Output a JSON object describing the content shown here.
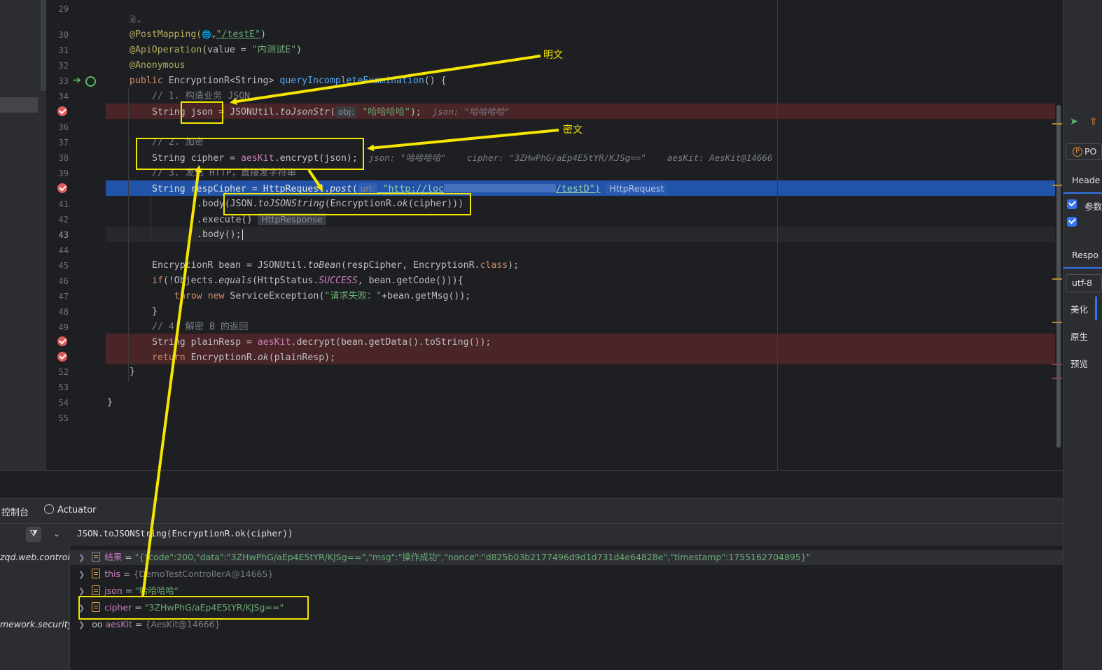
{
  "editor": {
    "line_numbers": [
      "29",
      "30",
      "31",
      "32",
      "33",
      "34",
      "35",
      "36",
      "37",
      "38",
      "39",
      "40",
      "41",
      "42",
      "43",
      "44",
      "45",
      "46",
      "47",
      "48",
      "49",
      "50",
      "51",
      "52",
      "53",
      "54",
      "55"
    ],
    "fold_hint": "🗟⌄",
    "lines": {
      "l30_ann": "@PostMapping(",
      "l30_globe": "🌐⌄",
      "l30_str": "\"/testE\"",
      "l30_end": ")",
      "l31_ann": "@ApiOperation",
      "l31_a": "(value = ",
      "l31_str": "\"内测试E\"",
      "l31_end": ")",
      "l32_ann": "@Anonymous",
      "l33_kw": "public ",
      "l33_type": "EncryptionR<String> ",
      "l33_fn": "queryIncompleteExamination",
      "l33_end": "() {",
      "l34_cm": "// 1. 构造业务 JSON",
      "l35_a": "String json = JSONUtil.",
      "l35_it": "toJsonStr",
      "l35_b": "(",
      "l35_hint": "obj:",
      "l35_str": " \"哈哈哈哈\"",
      "l35_end": ");",
      "l35_inlay": "json: \"哈哈哈哈\"",
      "l37_cm": "// 2. 加密",
      "l38_a": "String cipher = ",
      "l38_fld": "aesKit",
      "l38_b": ".encrypt(json);",
      "l38_inlay": "json: \"哈哈哈哈\"    cipher: \"3ZHwPhG/aEp4E5tYR/KJSg==\"    aesKit: AesKit@14666",
      "l39_cm": "// 3. 发送 HTTP，直接发字符串",
      "l40_a": "String respCipher = HttpRequest.",
      "l40_it": "post",
      "l40_b": "(",
      "l40_hint": "url:",
      "l40_str": " \"http://loc",
      "l40_str2": "/testD\")",
      "l40_tail": "HttpRequest",
      "l41_a": ".body(JSON.",
      "l41_it": "toJSONString",
      "l41_b": "(EncryptionR.",
      "l41_it2": "ok",
      "l41_c": "(cipher)))",
      "l42_a": ".execute()",
      "l42_tail": "HttpResponse",
      "l43_a": ".body();",
      "l45_a": "EncryptionR bean = JSONUtil.",
      "l45_it": "toBean",
      "l45_b": "(respCipher, EncryptionR.",
      "l45_kw": "class",
      "l45_c": ");",
      "l46_kw": "if",
      "l46_a": "(!Objects.",
      "l46_it": "equals",
      "l46_b": "(HttpStatus.",
      "l46_cn": "SUCCESS",
      "l46_c": ", bean.getCode())){",
      "l47_kw": "throw new ",
      "l47_a": "ServiceException(",
      "l47_str": "\"请求失败：\"",
      "l47_b": "+bean.getMsg());",
      "l48_a": "}",
      "l49_cm": "// 4. 解密 B 的返回",
      "l50_a": "String plainResp = ",
      "l50_fld": "aesKit",
      "l50_b": ".decrypt(bean.getData().toString());",
      "l51_kw": "return ",
      "l51_a": "EncryptionR.",
      "l51_it": "ok",
      "l51_b": "(plainResp);",
      "l52_a": "}",
      "l54_a": "}"
    }
  },
  "annotations": {
    "plaintext_label": "明文",
    "ciphertext_label": "密文",
    "color": "#f4e600"
  },
  "right_panel": {
    "method_badge": "P",
    "method_text": "PO",
    "headers_tab": "Heade",
    "params_label": "参数",
    "response_tab": "Respo",
    "encoding": "utf-8",
    "beautify": "美化",
    "raw": "原生",
    "preview": "预览"
  },
  "bottom": {
    "tab_console": "控制台",
    "tab_actuator": "Actuator",
    "expression": "JSON.toJSONString(EncryptionR.ok(cipher))",
    "frames": [
      "zqd.web.controlle",
      "mework.security.i"
    ],
    "variables": [
      {
        "name": "结果",
        "value": "\"{\"code\":200,\"data\":\"3ZHwPhG/aEp4E5tYR/KJSg==\",\"msg\":\"操作成功\",\"nonce\":\"d825b03b2177496d9d1d731d4e64828e\",\"timestamp\":1755162704895}\""
      },
      {
        "name": "this",
        "value": "{DemoTestControllerA@14665}"
      },
      {
        "name": "json",
        "value": "\"哈哈哈哈\""
      },
      {
        "name": "cipher",
        "value": "\"3ZHwPhG/aEp4E5tYR/KJSg==\""
      },
      {
        "name": "aesKit",
        "value": "{AesKit@14666}"
      }
    ]
  }
}
